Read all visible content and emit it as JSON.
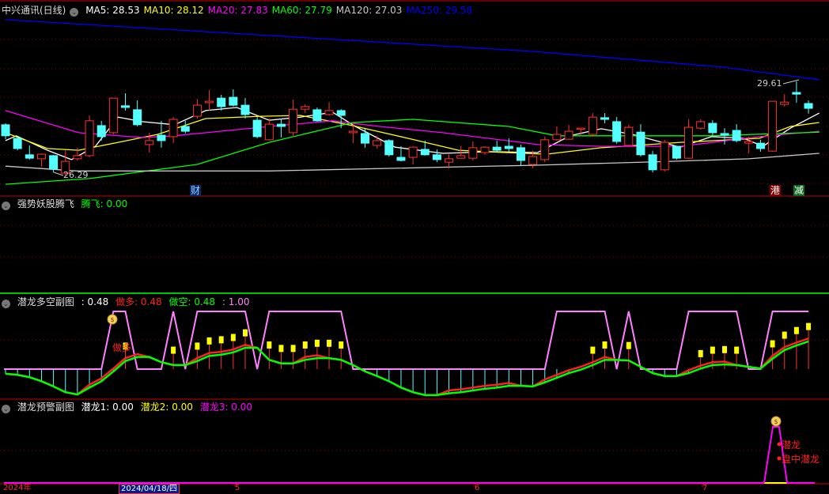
{
  "colors": {
    "up": "#ff3232",
    "down": "#54ffff",
    "ma5": "#ffffff",
    "ma10": "#ffff00",
    "ma20": "#ff00ff",
    "ma60": "#00ff00",
    "ma120": "#c8c8c8",
    "ma250": "#0000ff",
    "grid": "#8b0000",
    "pink": "#ff80ff"
  },
  "main": {
    "title": "中兴通讯(日线)",
    "ma": [
      {
        "label": "MA5: 28.53",
        "color": "#ffffff"
      },
      {
        "label": "MA10: 28.12",
        "color": "#ffff00"
      },
      {
        "label": "MA20: 27.83",
        "color": "#ff00ff"
      },
      {
        "label": "MA60: 27.79",
        "color": "#00ff00"
      },
      {
        "label": "MA120: 27.03",
        "color": "#c8c8c8"
      },
      {
        "label": "MA250: 29.58",
        "color": "#0000ff"
      }
    ],
    "high_label": "29.61",
    "low_label": "26.29",
    "badges": {
      "cai": "财",
      "gang": "港",
      "jian": "减"
    }
  },
  "chart_data": {
    "type": "candlestick",
    "price_range": [
      26.29,
      29.61
    ],
    "candles": [
      [
        28.08,
        28.13,
        27.57,
        27.69
      ],
      [
        27.6,
        27.66,
        27.18,
        27.24
      ],
      [
        27.02,
        27.35,
        26.85,
        26.9
      ],
      [
        26.88,
        27.07,
        26.6,
        27.04
      ],
      [
        26.99,
        27.02,
        26.4,
        26.51
      ],
      [
        26.37,
        27.18,
        26.29,
        26.79
      ],
      [
        26.88,
        27.27,
        26.82,
        26.99
      ],
      [
        26.99,
        28.41,
        26.93,
        28.22
      ],
      [
        28.05,
        28.22,
        27.52,
        27.66
      ],
      [
        27.8,
        29.02,
        27.74,
        29.02
      ],
      [
        28.75,
        29.19,
        28.58,
        28.69
      ],
      [
        28.61,
        28.94,
        28.02,
        28.08
      ],
      [
        27.38,
        27.8,
        27.1,
        27.52
      ],
      [
        27.71,
        28.22,
        27.27,
        27.52
      ],
      [
        27.66,
        28.35,
        27.43,
        28.27
      ],
      [
        28.02,
        28.22,
        27.77,
        27.85
      ],
      [
        28.38,
        28.99,
        28.3,
        28.77
      ],
      [
        28.86,
        29.3,
        28.58,
        28.91
      ],
      [
        29.02,
        29.14,
        28.58,
        28.72
      ],
      [
        29.05,
        29.33,
        28.72,
        28.77
      ],
      [
        28.77,
        29.02,
        28.3,
        28.44
      ],
      [
        28.24,
        28.35,
        27.6,
        27.66
      ],
      [
        27.55,
        28.3,
        27.52,
        28.1
      ],
      [
        28.1,
        28.3,
        27.63,
        28.02
      ],
      [
        27.8,
        28.97,
        27.69,
        28.63
      ],
      [
        28.63,
        28.8,
        28.49,
        28.72
      ],
      [
        28.61,
        28.69,
        28.19,
        28.22
      ],
      [
        28.44,
        28.88,
        28.41,
        28.58
      ],
      [
        28.58,
        28.63,
        27.96,
        28.41
      ],
      [
        27.8,
        28.16,
        27.43,
        27.85
      ],
      [
        27.77,
        27.94,
        27.27,
        27.43
      ],
      [
        27.35,
        27.69,
        27.24,
        27.52
      ],
      [
        27.52,
        27.57,
        26.96,
        27.02
      ],
      [
        26.93,
        27.32,
        26.79,
        26.82
      ],
      [
        26.93,
        27.32,
        26.68,
        27.29
      ],
      [
        27.21,
        27.52,
        26.99,
        27.02
      ],
      [
        27.02,
        27.21,
        26.76,
        26.85
      ],
      [
        26.76,
        27.04,
        26.54,
        26.88
      ],
      [
        26.9,
        27.32,
        26.88,
        26.99
      ],
      [
        26.9,
        27.49,
        26.82,
        27.27
      ],
      [
        27.1,
        27.32,
        27.02,
        27.29
      ],
      [
        27.29,
        27.52,
        27.1,
        27.18
      ],
      [
        27.32,
        27.6,
        27.13,
        27.24
      ],
      [
        27.27,
        27.38,
        26.62,
        26.82
      ],
      [
        26.68,
        27.16,
        26.54,
        26.96
      ],
      [
        26.85,
        27.66,
        26.76,
        27.55
      ],
      [
        27.55,
        28.02,
        27.52,
        27.74
      ],
      [
        27.57,
        28.08,
        27.55,
        27.85
      ],
      [
        27.94,
        27.96,
        27.69,
        27.96
      ],
      [
        27.74,
        28.49,
        27.66,
        28.35
      ],
      [
        28.33,
        28.49,
        28.13,
        28.27
      ],
      [
        28.19,
        28.35,
        27.41,
        27.49
      ],
      [
        27.35,
        28.08,
        27.32,
        27.99
      ],
      [
        27.82,
        28.1,
        26.96,
        27.02
      ],
      [
        27.02,
        27.16,
        26.4,
        26.49
      ],
      [
        26.49,
        27.55,
        26.43,
        27.46
      ],
      [
        27.32,
        27.32,
        26.85,
        26.9
      ],
      [
        26.9,
        28.27,
        26.88,
        27.99
      ],
      [
        27.96,
        28.27,
        27.91,
        28.19
      ],
      [
        28.13,
        28.24,
        27.69,
        27.8
      ],
      [
        27.77,
        27.96,
        27.38,
        27.71
      ],
      [
        27.88,
        28.1,
        27.46,
        27.52
      ],
      [
        27.43,
        27.66,
        27.07,
        27.49
      ],
      [
        27.43,
        27.55,
        27.13,
        27.24
      ],
      [
        27.15,
        28.91,
        27.13,
        28.91
      ],
      [
        28.8,
        29.16,
        28.72,
        28.88
      ],
      [
        29.22,
        29.61,
        28.86,
        29.16
      ],
      [
        28.83,
        28.94,
        28.47,
        28.66
      ]
    ],
    "ma_series": {
      "ma5": [
        [
          0,
          27.52
        ],
        [
          0.9,
          27.69
        ],
        [
          3.5,
          27.18
        ],
        [
          5.5,
          26.85
        ],
        [
          7.5,
          27.32
        ],
        [
          9.4,
          28.35
        ],
        [
          11.4,
          28.19
        ],
        [
          14.1,
          28.08
        ],
        [
          16.7,
          28.58
        ],
        [
          19.3,
          28.69
        ],
        [
          22,
          28.24
        ],
        [
          24.6,
          28.35
        ],
        [
          27.3,
          28.52
        ],
        [
          29.2,
          28.02
        ],
        [
          32.5,
          27.29
        ],
        [
          36.5,
          27.07
        ],
        [
          40.5,
          27.13
        ],
        [
          44.4,
          27.1
        ],
        [
          47.1,
          27.69
        ],
        [
          49.7,
          27.94
        ],
        [
          52.3,
          27.74
        ],
        [
          56.3,
          27.29
        ],
        [
          58.9,
          27.66
        ],
        [
          61.6,
          27.6
        ],
        [
          63.2,
          27.32
        ],
        [
          65.5,
          27.96
        ],
        [
          67.9,
          28.49
        ]
      ],
      "ma10": [
        [
          0,
          27.8
        ],
        [
          3.5,
          27.24
        ],
        [
          6.1,
          27.18
        ],
        [
          9.4,
          27.46
        ],
        [
          12.7,
          27.74
        ],
        [
          16.7,
          28.3
        ],
        [
          21.3,
          28.38
        ],
        [
          24.6,
          28.41
        ],
        [
          28.6,
          28.08
        ],
        [
          33.9,
          27.57
        ],
        [
          37.8,
          27.18
        ],
        [
          41.8,
          27.1
        ],
        [
          45.1,
          27.04
        ],
        [
          49.7,
          27.27
        ],
        [
          53.7,
          27.38
        ],
        [
          56.3,
          27.46
        ],
        [
          62.9,
          27.6
        ],
        [
          65.5,
          28.02
        ],
        [
          67.9,
          28.16
        ]
      ],
      "ma20": [
        [
          0,
          28.58
        ],
        [
          6.1,
          27.8
        ],
        [
          11.4,
          27.63
        ],
        [
          14.1,
          27.69
        ],
        [
          22,
          28.02
        ],
        [
          27.3,
          28.22
        ],
        [
          31.2,
          28.02
        ],
        [
          36.5,
          27.8
        ],
        [
          41.8,
          27.52
        ],
        [
          44.4,
          27.38
        ],
        [
          49.7,
          27.32
        ],
        [
          56.3,
          27.32
        ],
        [
          62.9,
          27.66
        ],
        [
          67.9,
          27.85
        ]
      ],
      "ma60": [
        [
          0,
          25.98
        ],
        [
          7,
          26.18
        ],
        [
          16,
          26.68
        ],
        [
          22,
          27.46
        ],
        [
          29,
          28.16
        ],
        [
          34,
          28.27
        ],
        [
          42,
          28.02
        ],
        [
          46,
          27.69
        ],
        [
          59,
          27.69
        ],
        [
          67.9,
          27.82
        ]
      ],
      "ma120": [
        [
          0,
          26.62
        ],
        [
          6,
          26.45
        ],
        [
          22,
          26.45
        ],
        [
          44,
          26.65
        ],
        [
          55,
          26.78
        ],
        [
          62,
          26.88
        ],
        [
          67.9,
          27.07
        ]
      ],
      "ma250": [
        [
          0,
          31.79
        ],
        [
          22,
          31.23
        ],
        [
          44,
          30.67
        ],
        [
          60,
          30.11
        ],
        [
          67.9,
          29.67
        ]
      ]
    }
  },
  "panel2": {
    "title": "强势妖股腾飞",
    "value_label": "腾飞: 0.00"
  },
  "panel3": {
    "title": "潜龙多空副图",
    "value": ": 0.48",
    "long_label": "做多: 0.48",
    "short_label": "做空: 0.48",
    "extra": ": 1.00",
    "signal_text": "做多",
    "pink_state": [
      0,
      0,
      0,
      0,
      0,
      0,
      0,
      0,
      0,
      1,
      1,
      0,
      0,
      0,
      1,
      0,
      1,
      1,
      1,
      1,
      1,
      0,
      1,
      1,
      1,
      1,
      1,
      1,
      1,
      0,
      0,
      0,
      0,
      0,
      0,
      0,
      0,
      0,
      0,
      0,
      0,
      0,
      0,
      0,
      0,
      0,
      1,
      1,
      1,
      1,
      1,
      0,
      1,
      0,
      0,
      0,
      0,
      1,
      1,
      1,
      1,
      1,
      0,
      0,
      1,
      1,
      1,
      1
    ],
    "line": [
      -0.08,
      -0.1,
      -0.14,
      -0.21,
      -0.3,
      -0.4,
      -0.44,
      -0.32,
      -0.21,
      -0.04,
      0.14,
      0.21,
      0.21,
      0.12,
      0.07,
      0.07,
      0.14,
      0.23,
      0.25,
      0.29,
      0.37,
      0.37,
      0.16,
      0.1,
      0.1,
      0.16,
      0.19,
      0.19,
      0.16,
      0.07,
      -0.04,
      -0.12,
      -0.21,
      -0.32,
      -0.4,
      -0.45,
      -0.45,
      -0.42,
      -0.4,
      -0.37,
      -0.34,
      -0.32,
      -0.29,
      -0.29,
      -0.3,
      -0.23,
      -0.15,
      -0.07,
      -0.01,
      0.07,
      0.16,
      0.16,
      0.15,
      0.04,
      -0.07,
      -0.12,
      -0.12,
      -0.07,
      0.01,
      0.07,
      0.08,
      0.07,
      0.04,
      0.01,
      0.18,
      0.33,
      0.41,
      0.48
    ]
  },
  "panel4": {
    "title": "潜龙预警副图",
    "v1": "潜龙1: 0.00",
    "v2": "潜龙2: 0.00",
    "v3": "潜龙3: 0.00",
    "signal1": "潜龙",
    "signal2": "盘中潜龙"
  },
  "xaxis": {
    "year": "2024年",
    "cursor_date": "2024/04/18/四",
    "months": [
      "5",
      "6",
      "7"
    ]
  }
}
